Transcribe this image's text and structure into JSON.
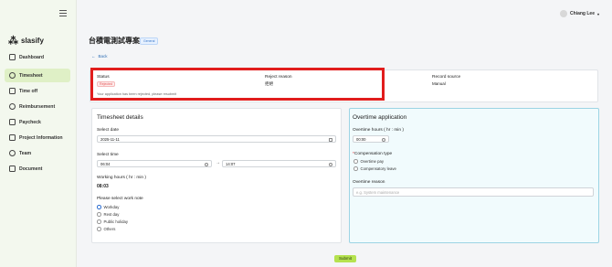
{
  "sidebar": {
    "logo_mark": "⁂",
    "logo_text": "slasify",
    "items": [
      {
        "label": "Dashboard",
        "icon": "dashboard-icon"
      },
      {
        "label": "Timesheet",
        "icon": "clock-icon"
      },
      {
        "label": "Time off",
        "icon": "calendar-icon"
      },
      {
        "label": "Reimbursement",
        "icon": "reimbursement-icon"
      },
      {
        "label": "Paycheck",
        "icon": "paycheck-icon"
      },
      {
        "label": "Project Information",
        "icon": "project-icon"
      },
      {
        "label": "Team",
        "icon": "team-icon"
      },
      {
        "label": "Document",
        "icon": "document-icon"
      }
    ]
  },
  "topbar": {
    "user_name": "Chiang Lee"
  },
  "page": {
    "title": "台積電測試專案",
    "badge": "General",
    "back_label": "Back"
  },
  "status": {
    "status_label": "Status",
    "status_value": "Rejected",
    "message": "Your application has been rejected, please resubmit",
    "reject_reason_label": "Reject reason",
    "reject_reason_value": "拒絕",
    "record_source_label": "Record source",
    "record_source_value": "Manual"
  },
  "timesheet": {
    "title": "Timesheet details",
    "date_label": "Select date",
    "date_value": "2025-11-11",
    "time_label": "Select time",
    "time_start": "06:04",
    "time_end": "14:07",
    "hours_label": "Working hours ( hr : min )",
    "hours_value": "08:03",
    "work_note_label": "Please select work note",
    "work_notes": [
      "Workday",
      "Rest day",
      "Public holiday",
      "Others"
    ],
    "work_note_selected": "Workday"
  },
  "overtime": {
    "title": "Overtime application",
    "hours_label": "Overtime hours ( hr : min )",
    "hours_value": "00:00",
    "comp_label": "Compensation type",
    "comp_options": [
      "Overtime pay",
      "Compensatory leave"
    ],
    "reason_label": "Overtime reason",
    "reason_placeholder": "e.g. System maintenance"
  },
  "actions": {
    "submit_label": "Submit"
  },
  "colors": {
    "accent": "#b5e24f",
    "sidebar_active": "#dff0c6",
    "highlight": "#e11d1d"
  }
}
